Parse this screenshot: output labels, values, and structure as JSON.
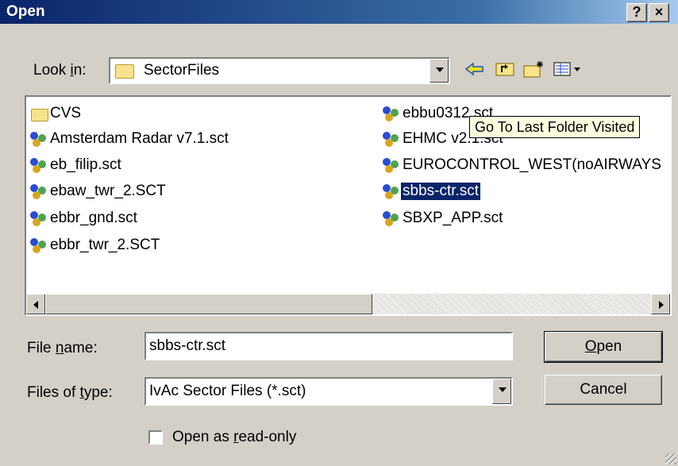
{
  "window": {
    "title": "Open",
    "help_label": "?",
    "close_label": "×"
  },
  "look_in": {
    "label_pre": "Look ",
    "label_accel": "i",
    "label_post": "n:",
    "value": "SectorFiles"
  },
  "toolbar": {
    "back_icon": "back-arrow-icon",
    "up_icon": "up-folder-icon",
    "new_folder_icon": "new-folder-icon",
    "view_icon": "view-menu-icon"
  },
  "files": {
    "left": [
      {
        "name": "CVS",
        "icon": "folder"
      },
      {
        "name": "Amsterdam Radar v7.1.sct",
        "icon": "sct"
      },
      {
        "name": "eb_filip.sct",
        "icon": "sct"
      },
      {
        "name": "ebaw_twr_2.SCT",
        "icon": "sct"
      },
      {
        "name": "ebbr_gnd.sct",
        "icon": "sct"
      },
      {
        "name": "ebbr_twr_2.SCT",
        "icon": "sct"
      }
    ],
    "right": [
      {
        "name": "ebbu0312.sct",
        "icon": "sct"
      },
      {
        "name": "EHMC v2.1.sct",
        "icon": "sct"
      },
      {
        "name": "EUROCONTROL_WEST(noAIRWAYS",
        "icon": "sct"
      },
      {
        "name": "sbbs-ctr.sct",
        "icon": "sct",
        "selected": true
      },
      {
        "name": "SBXP_APP.sct",
        "icon": "sct"
      }
    ]
  },
  "tooltip": "Go To Last Folder Visited",
  "file_name": {
    "label_pre": "File ",
    "label_accel": "n",
    "label_post": "ame:",
    "value": "sbbs-ctr.sct"
  },
  "file_type": {
    "label_pre": "Files of ",
    "label_accel": "t",
    "label_post": "ype:",
    "value": "IvAc Sector Files (*.sct)"
  },
  "buttons": {
    "open_accel": "O",
    "open_rest": "pen",
    "cancel": "Cancel"
  },
  "read_only": {
    "label_pre": "Open as ",
    "label_accel": "r",
    "label_post": "ead-only",
    "checked": false
  },
  "colors": {
    "titlebar": "#0a246a",
    "selection": "#0a246a",
    "tooltip_bg": "#ffffe1",
    "face": "#d4d0c8"
  }
}
